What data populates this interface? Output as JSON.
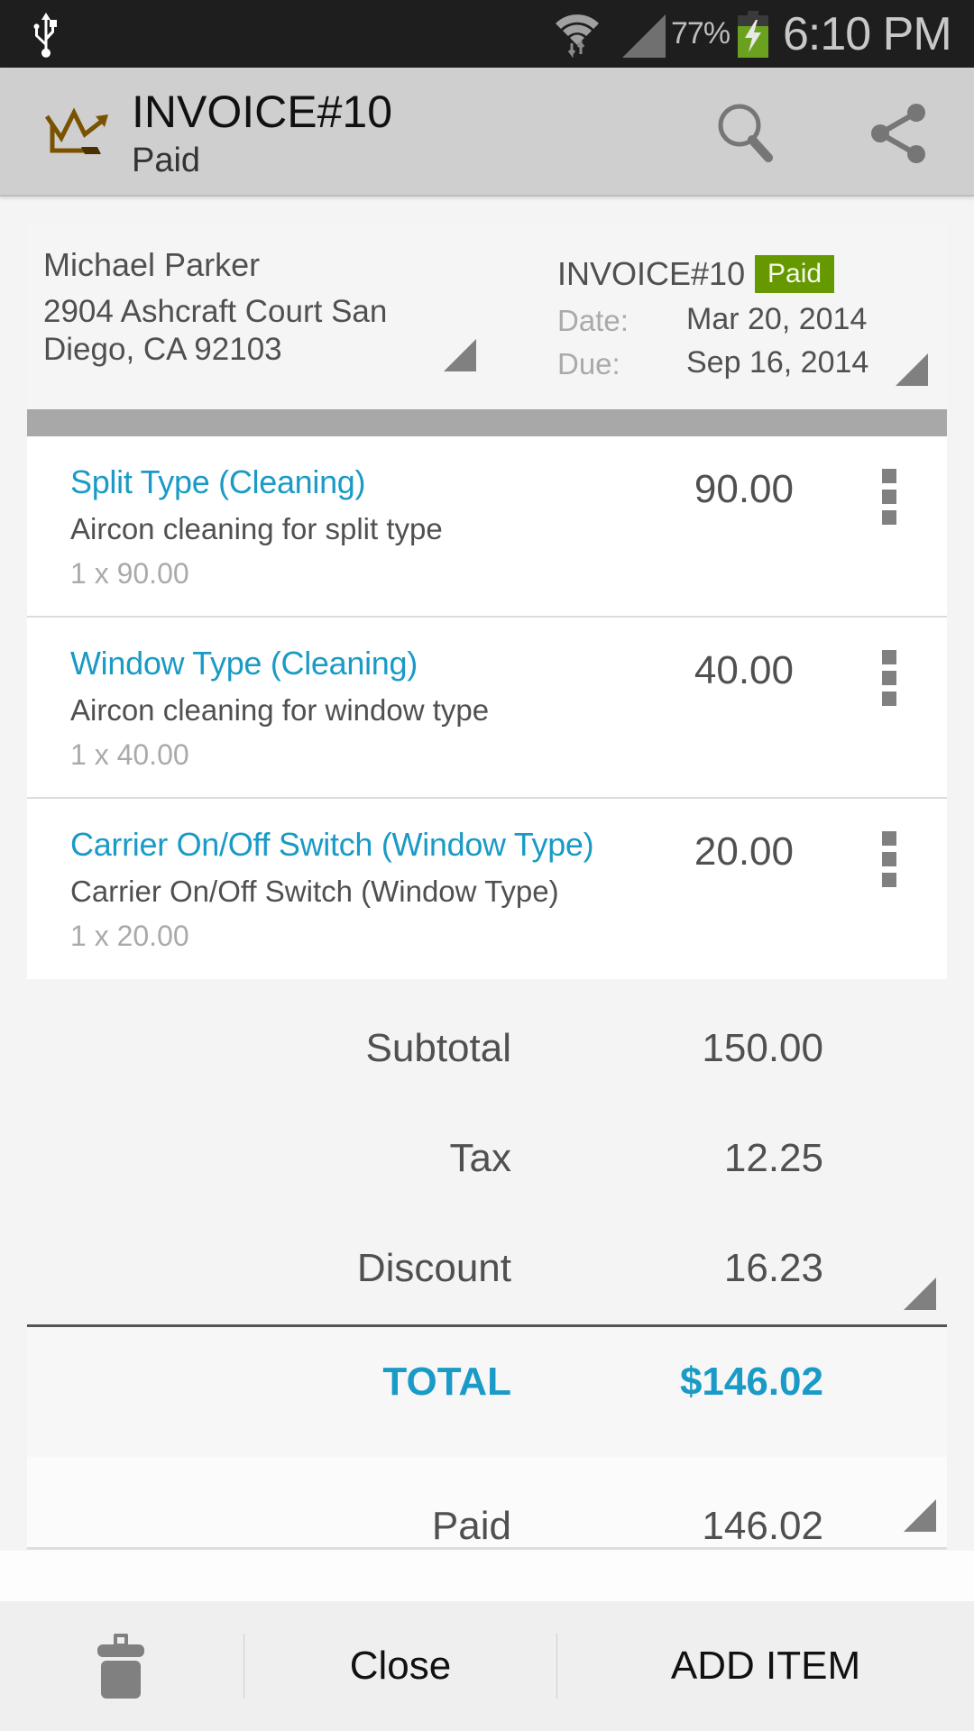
{
  "status_bar": {
    "battery_percent": "77%",
    "time": "6:10 PM",
    "icons": [
      "usb-icon",
      "wifi-icon",
      "signal-icon",
      "battery-charging-icon"
    ]
  },
  "action_bar": {
    "title": "INVOICE#10",
    "subtitle": "Paid",
    "logo_icon": "crown-logo-icon",
    "actions": [
      "search-icon",
      "share-icon"
    ],
    "logo_color": "#7a5200"
  },
  "header": {
    "client": {
      "name": "Michael Parker",
      "address": "2904 Ashcraft Court San Diego, CA 92103"
    },
    "invoice": {
      "number": "INVOICE#10",
      "status_badge": "Paid",
      "badge_color": "#669900",
      "date_label": "Date:",
      "date_value": "Mar 20, 2014",
      "due_label": "Due:",
      "due_value": "Sep 16, 2014"
    }
  },
  "items": [
    {
      "name": "Split Type (Cleaning)",
      "description": "Aircon cleaning for split type",
      "quantity_line": "1 x 90.00",
      "amount": "90.00"
    },
    {
      "name": "Window Type (Cleaning)",
      "description": "Aircon cleaning for window type",
      "quantity_line": "1 x 40.00",
      "amount": "40.00"
    },
    {
      "name": "Carrier On/Off Switch (Window Type)",
      "description": "Carrier On/Off Switch (Window Type)",
      "quantity_line": "1 x 20.00",
      "amount": "20.00"
    }
  ],
  "totals": {
    "subtotal_label": "Subtotal",
    "subtotal_value": "150.00",
    "tax_label": "Tax",
    "tax_value": "12.25",
    "discount_label": "Discount",
    "discount_value": "16.23",
    "total_label": "TOTAL",
    "total_value": "$146.02",
    "paid_label": "Paid",
    "paid_value": "146.02",
    "accent_color": "#1a9ac6"
  },
  "bottom_bar": {
    "delete_icon": "trash-icon",
    "close_label": "Close",
    "add_item_label": "ADD ITEM"
  }
}
